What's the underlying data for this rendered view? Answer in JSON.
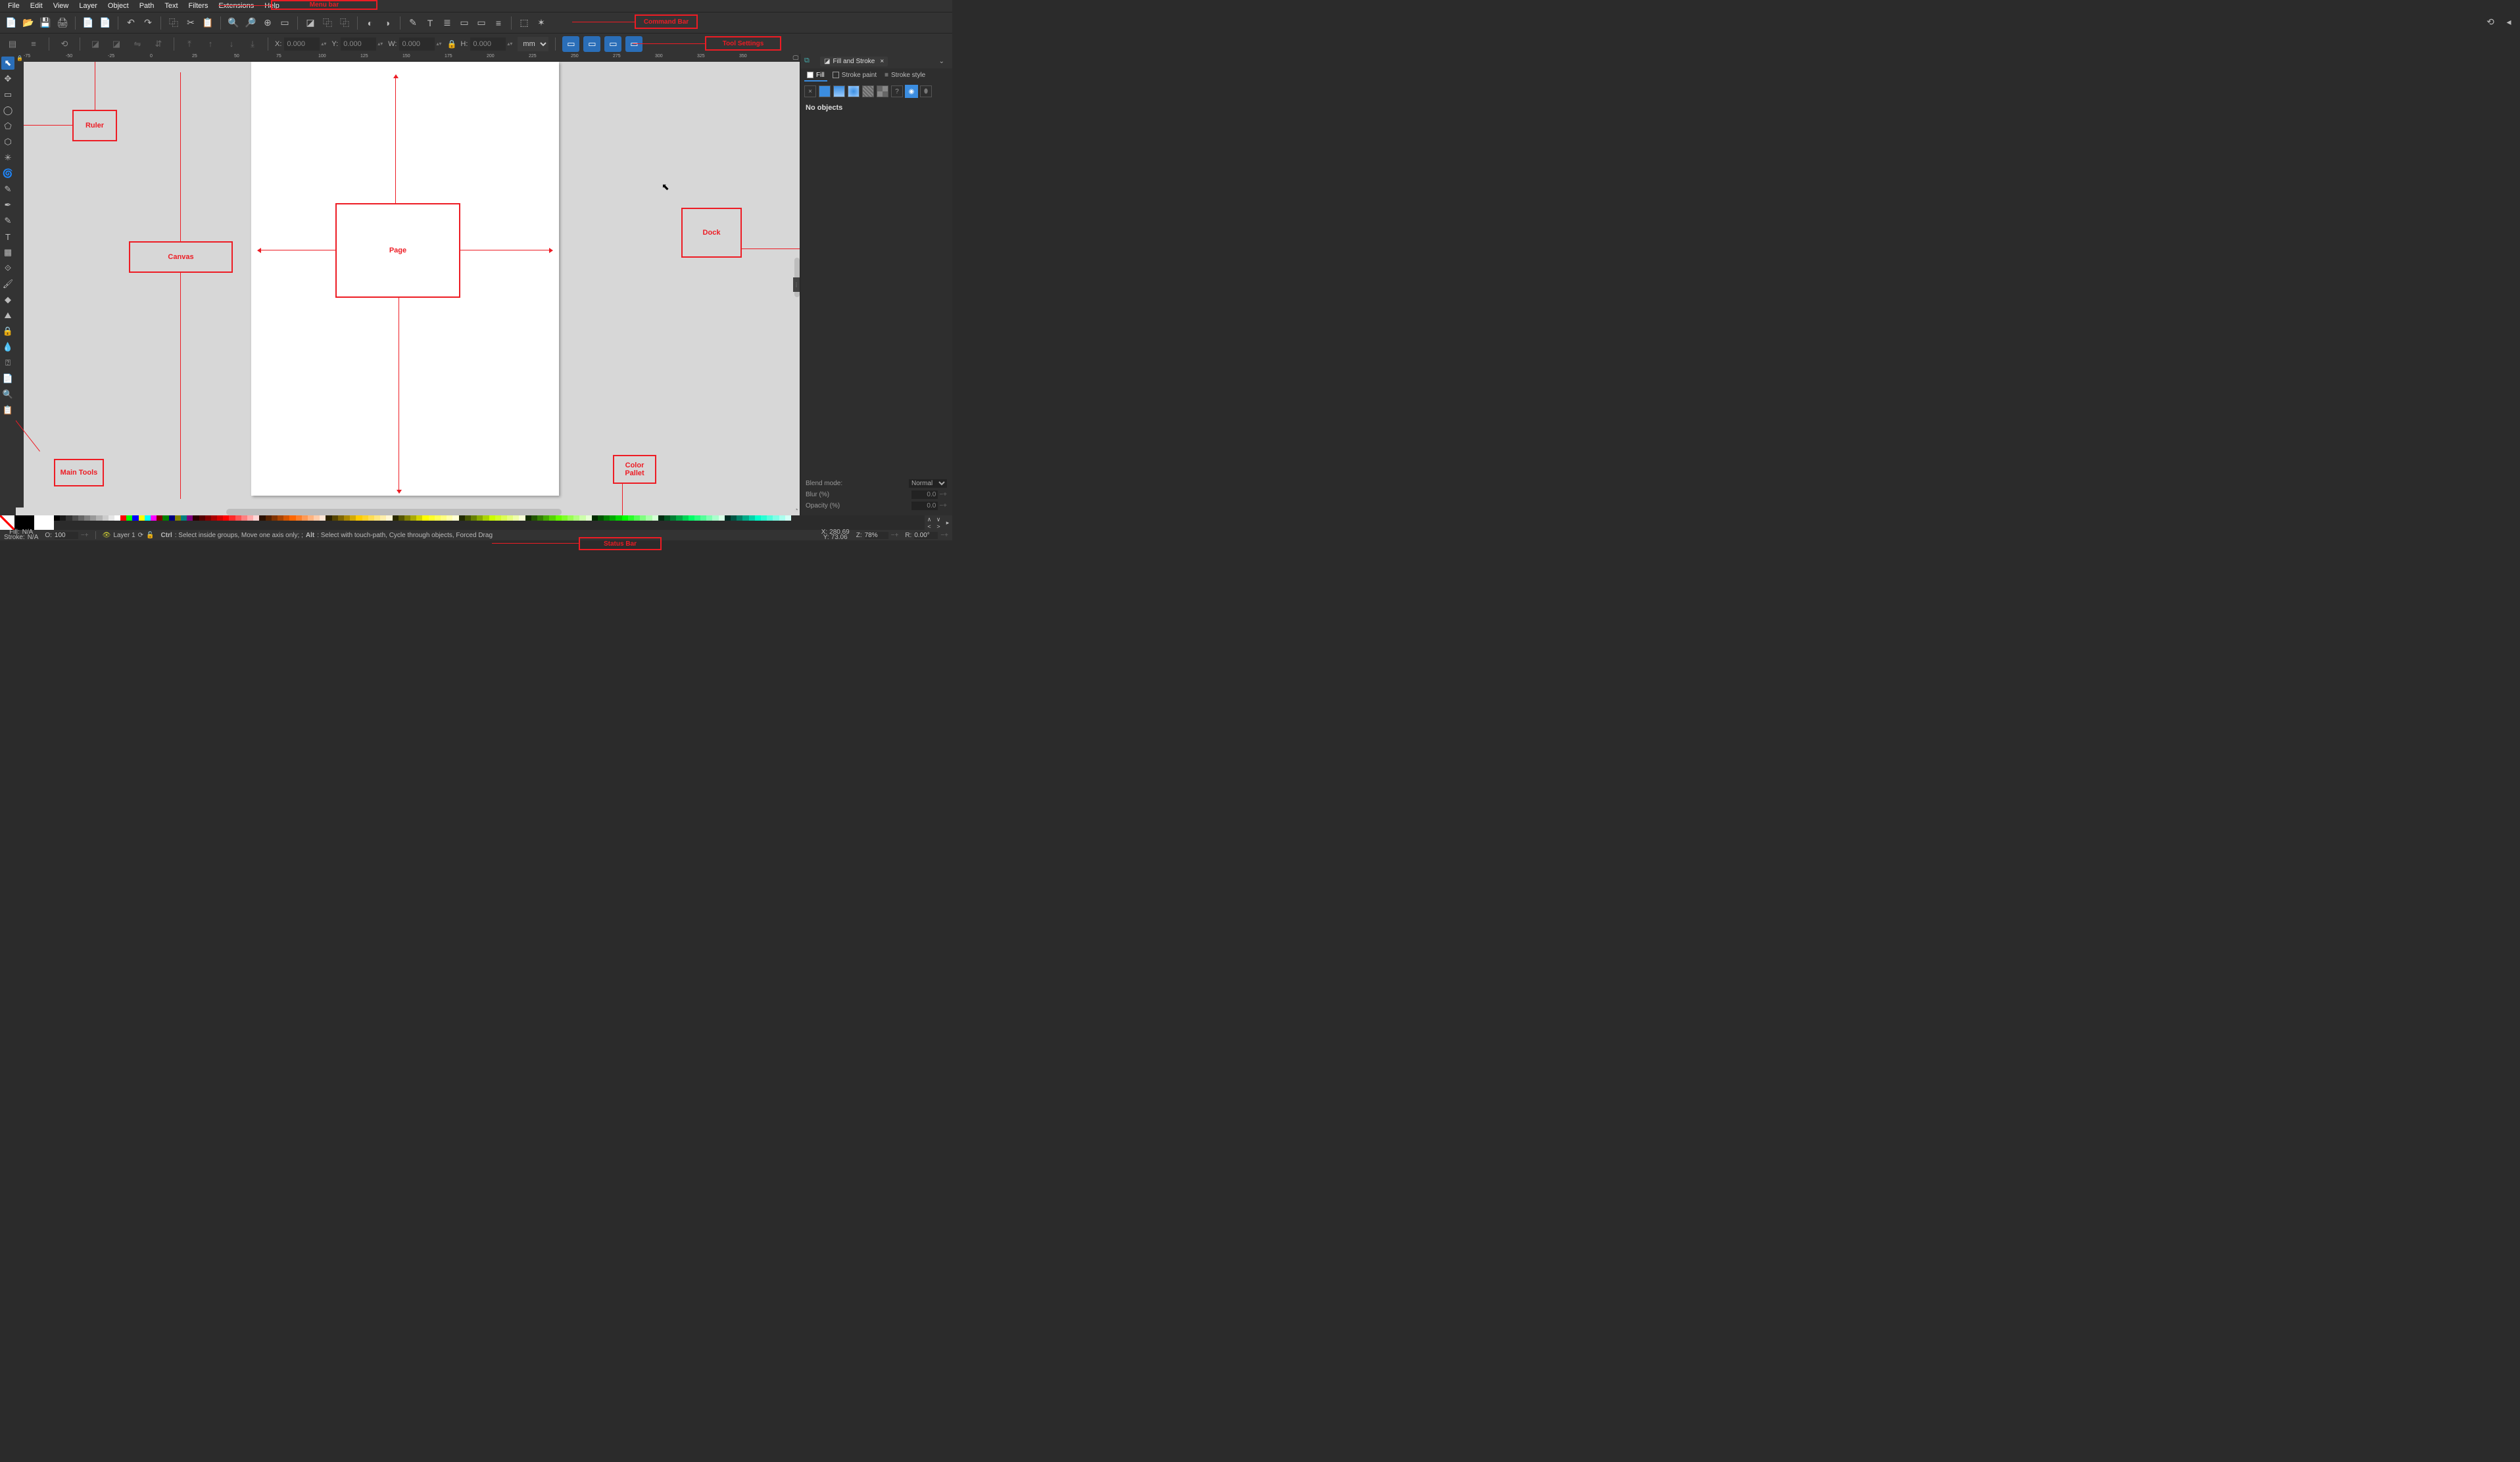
{
  "menu": [
    "File",
    "Edit",
    "View",
    "Layer",
    "Object",
    "Path",
    "Text",
    "Filters",
    "Extensions",
    "Help"
  ],
  "cmd_icons": [
    "📄",
    "📂",
    "💾",
    "🖨",
    "",
    "📄",
    "📄",
    "",
    "↶",
    "↷",
    "",
    "⿻",
    "✂",
    "📋",
    "",
    "🔍",
    "🔎",
    "⊕",
    "▭",
    "",
    "◪",
    "⿻",
    "⿻",
    "",
    "◐",
    "◑",
    "",
    "✎",
    "T",
    "≣",
    "▭",
    "▭",
    "≡",
    "",
    "⬚",
    "✶"
  ],
  "toolset": {
    "x_label": "X:",
    "x": "0.000",
    "y_label": "Y:",
    "y": "0.000",
    "w_label": "W:",
    "w": "0.000",
    "h_label": "H:",
    "h": "0.000",
    "unit": "mm"
  },
  "tools": [
    "⬉",
    "✥",
    "▭",
    "◯",
    "⬠",
    "⬡",
    "✳",
    "🌀",
    "✎",
    "✒",
    "✎",
    "T",
    "▦",
    "⟐",
    "🖌",
    "◆",
    "⛰",
    "🔒",
    "💧",
    "⍰",
    "📄",
    "🔍",
    "📋"
  ],
  "ruler_ticks": [
    -75,
    -50,
    -25,
    0,
    25,
    50,
    75,
    100,
    125,
    150,
    175,
    200,
    225,
    250,
    275,
    300,
    325,
    350
  ],
  "annotations": {
    "menubar": "Menu bar",
    "commandbar": "Command Bar",
    "toolsettings": "Tool Settings",
    "ruler": "Ruler",
    "canvas": "Canvas",
    "page": "Page",
    "dock": "Dock",
    "maintools": "Main Tools",
    "palette": "Color\nPallet",
    "statusbar": "Status Bar"
  },
  "dock": {
    "title": "Fill and Stroke",
    "tab_fill": "Fill",
    "tab_strokepaint": "Stroke paint",
    "tab_strokestyle": "Stroke style",
    "noobjects": "No objects",
    "blendmode_label": "Blend mode:",
    "blendmode": "Normal",
    "blur_label": "Blur (%)",
    "blur": "0.0",
    "opacity_label": "Opacity (%)",
    "opacity": "0.0"
  },
  "palette_colors": [
    "#000000",
    "#1a1a1a",
    "#333333",
    "#4d4d4d",
    "#666666",
    "#808080",
    "#999999",
    "#b3b3b3",
    "#cccccc",
    "#e6e6e6",
    "#ffffff",
    "#ff0000",
    "#00ff00",
    "#0000ff",
    "#ffff00",
    "#00ffff",
    "#ff00ff",
    "#800000",
    "#008000",
    "#000080",
    "#808000",
    "#008080",
    "#800080",
    "#2b0000",
    "#550000",
    "#800000",
    "#aa0000",
    "#d40000",
    "#ff0000",
    "#ff2a2a",
    "#ff5555",
    "#ff8080",
    "#ffaaaa",
    "#ffd5d5",
    "#2b1100",
    "#552200",
    "#803300",
    "#aa4400",
    "#d45500",
    "#ff6600",
    "#ff7f2a",
    "#ff9955",
    "#ffb380",
    "#ffccaa",
    "#ffe6d5",
    "#2b2200",
    "#554400",
    "#806600",
    "#aa8800",
    "#d4aa00",
    "#ffcc00",
    "#ffd42a",
    "#ffdd55",
    "#ffe680",
    "#ffeeaa",
    "#fff6d5",
    "#2b2b00",
    "#555500",
    "#808000",
    "#aaaa00",
    "#d4d400",
    "#ffff00",
    "#ffff2a",
    "#ffff55",
    "#ffff80",
    "#ffffaa",
    "#ffffd5",
    "#222b00",
    "#445500",
    "#668000",
    "#88aa00",
    "#aad400",
    "#ccff00",
    "#d4ff2a",
    "#ddff55",
    "#e5ff80",
    "#eeffaa",
    "#f6ffd5",
    "#112b00",
    "#225500",
    "#338000",
    "#44aa00",
    "#55d400",
    "#66ff00",
    "#7fff2a",
    "#99ff55",
    "#b3ff80",
    "#ccffaa",
    "#e6ffd5",
    "#002b00",
    "#005500",
    "#008000",
    "#00aa00",
    "#00d400",
    "#00ff00",
    "#2aff2a",
    "#55ff55",
    "#80ff80",
    "#aaffaa",
    "#d5ffd5",
    "#002b11",
    "#005522",
    "#008033",
    "#00aa44",
    "#00d455",
    "#00ff66",
    "#2aff7f",
    "#55ff99",
    "#80ffb3",
    "#aaffcc",
    "#d5ffe6",
    "#002b22",
    "#005544",
    "#008066",
    "#00aa88",
    "#00d4aa",
    "#00ffcc",
    "#2affd4",
    "#55ffdd",
    "#80ffe6",
    "#aaffee",
    "#d5fff6"
  ],
  "status": {
    "fill_label": "Fill:",
    "fill": "N/A",
    "stroke_label": "Stroke:",
    "stroke": "N/A",
    "o_label": "O:",
    "o": "100",
    "layer": "Layer 1",
    "hint_ctrl": "Ctrl",
    "hint_ctrl_text": ": Select inside groups, Move one axis only; ; ",
    "hint_alt": "Alt",
    "hint_alt_text": ": Select with touch-path, Cycle through objects, Forced Drag",
    "x_label": "X:",
    "x": "280.69",
    "y_label": "Y:",
    "y": "73.06",
    "z_label": "Z:",
    "z": "78%",
    "r_label": "R:",
    "r": "0.00°"
  }
}
